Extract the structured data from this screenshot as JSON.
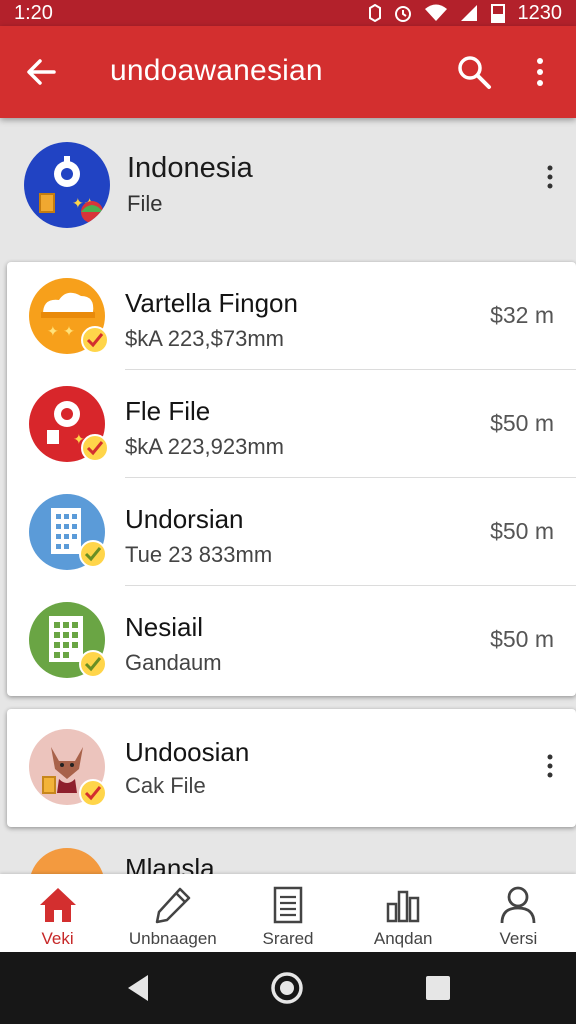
{
  "status_bar": {
    "time": "1:20",
    "right_time": "1230"
  },
  "app_bar": {
    "title": "undoawanesian"
  },
  "header": {
    "name": "Indonesia",
    "subtitle": "File"
  },
  "files": [
    {
      "name": "Vartella Fingon",
      "meta": "$kA 223,$73mm",
      "size": "$32 m",
      "icon": "cloud-folder-icon"
    },
    {
      "name": "Fle File",
      "meta": "$kA 223,923mm",
      "size": "$50 m",
      "icon": "red-location-icon"
    },
    {
      "name": "Undorsian",
      "meta": "Tue 23 833mm",
      "size": "$50 m",
      "icon": "blue-building-icon"
    },
    {
      "name": "Nesiail",
      "meta": "Gandaum",
      "size": "$50 m",
      "icon": "green-building-icon"
    }
  ],
  "single_item": {
    "name": "Undoosian",
    "meta": "Cak File",
    "icon": "fox-icon"
  },
  "peek_item": {
    "name": "Mlansla"
  },
  "bottom_nav": [
    {
      "label": "Veki",
      "icon": "home-icon",
      "active": true
    },
    {
      "label": "Unbnaagen",
      "icon": "pen-icon",
      "active": false
    },
    {
      "label": "Srared",
      "icon": "document-icon",
      "active": false
    },
    {
      "label": "Anqdan",
      "icon": "chart-icon",
      "active": false
    },
    {
      "label": "Versi",
      "icon": "person-icon",
      "active": false
    }
  ],
  "colors": {
    "primary": "#d32f2f",
    "status": "#b3212b",
    "active": "#c62828"
  }
}
